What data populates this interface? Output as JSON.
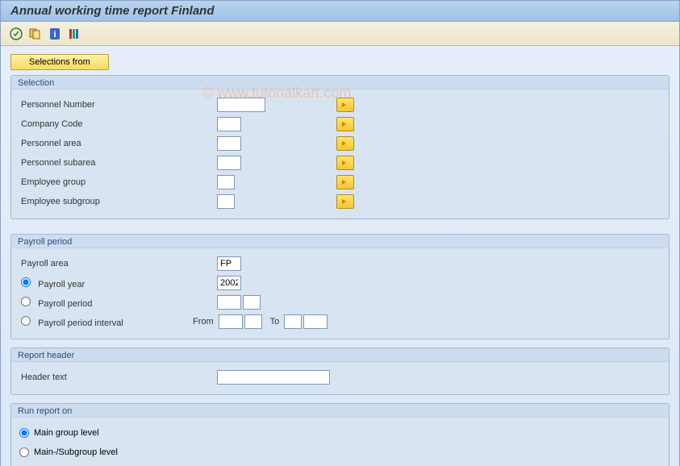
{
  "title": "Annual working time report Finland",
  "watermark": "© www.tutorialkart.com",
  "selections_button": "Selections from",
  "groups": {
    "selection": {
      "title": "Selection",
      "fields": {
        "personnel_number": "Personnel Number",
        "company_code": "Company Code",
        "personnel_area": "Personnel area",
        "personnel_subarea": "Personnel subarea",
        "employee_group": "Employee group",
        "employee_subgroup": "Employee subgroup"
      }
    },
    "payroll_period": {
      "title": "Payroll period",
      "payroll_area_label": "Payroll area",
      "payroll_area_value": "FP",
      "payroll_year_label": "Payroll year",
      "payroll_year_value": "2002",
      "payroll_period_label": "Payroll period",
      "payroll_interval_label": "Payroll period interval",
      "from_label": "From",
      "to_label": "To"
    },
    "report_header": {
      "title": "Report header",
      "header_text_label": "Header text"
    },
    "run_report": {
      "title": "Run report on",
      "main_group_label": "Main group level",
      "subgroup_label": "Main-/Subgroup level"
    }
  }
}
